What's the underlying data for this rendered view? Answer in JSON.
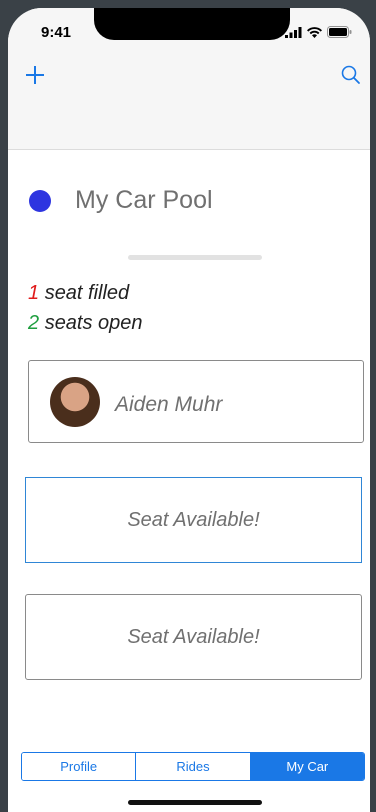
{
  "status": {
    "time": "9:41"
  },
  "pool": {
    "title": "My Car Pool",
    "dot_color": "#2e35e0"
  },
  "seats": {
    "filled_count": "1",
    "filled_label": "seat filled",
    "open_count": "2",
    "open_label": "seats open"
  },
  "riders": [
    {
      "name": "Aiden Muhr"
    }
  ],
  "open_seats": [
    {
      "label": "Seat Available!",
      "highlighted": true
    },
    {
      "label": "Seat Available!",
      "highlighted": false
    }
  ],
  "tabs": [
    {
      "label": "Profile",
      "selected": false
    },
    {
      "label": "Rides",
      "selected": false
    },
    {
      "label": "My Car",
      "selected": true
    }
  ],
  "icons": {
    "add": "plus-icon",
    "search": "search-icon"
  },
  "colors": {
    "accent": "#1a78e6",
    "filled": "#e01b1b",
    "open": "#1e9e3e"
  }
}
